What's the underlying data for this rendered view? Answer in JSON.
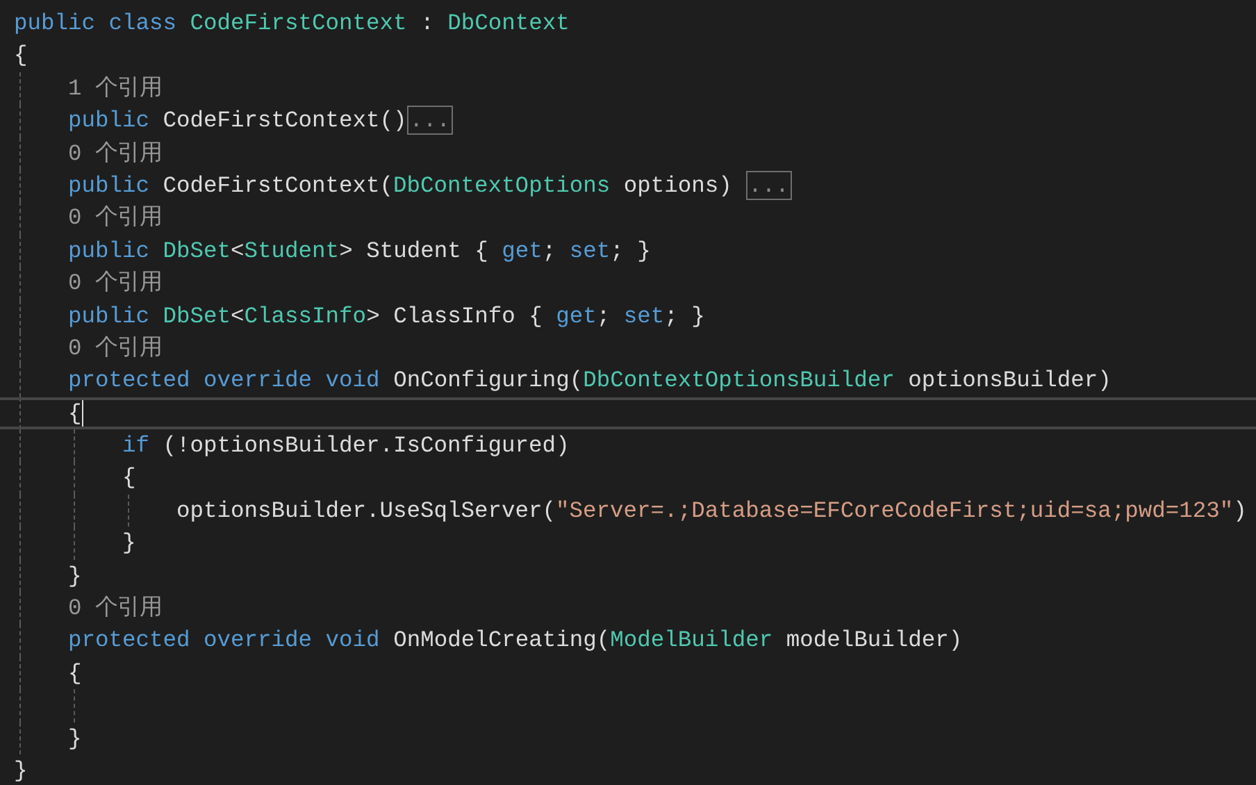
{
  "editor": {
    "lines": [
      {
        "current": false,
        "code": [
          {
            "text": "public ",
            "kind": "keyword"
          },
          {
            "text": "class ",
            "kind": "keyword"
          },
          {
            "text": "CodeFirstContext",
            "kind": "type"
          },
          {
            "text": " : ",
            "kind": "plain"
          },
          {
            "text": "DbContext",
            "kind": "type"
          }
        ]
      },
      {
        "current": false,
        "code": [
          {
            "text": "{",
            "kind": "plain"
          }
        ]
      },
      {
        "current": false,
        "code": [
          {
            "text": "    1 个引用",
            "kind": "lens"
          }
        ]
      },
      {
        "current": false,
        "code": [
          {
            "text": "    public",
            "kind": "keyword"
          },
          {
            "text": " CodeFirstContext()",
            "kind": "plain"
          }
        ],
        "collapsed": "..."
      },
      {
        "current": false,
        "code": [
          {
            "text": "    0 个引用",
            "kind": "lens"
          }
        ]
      },
      {
        "current": false,
        "code": [
          {
            "text": "    public",
            "kind": "keyword"
          },
          {
            "text": " CodeFirstContext(",
            "kind": "plain"
          },
          {
            "text": "DbContextOptions",
            "kind": "type"
          },
          {
            "text": " options) ",
            "kind": "plain"
          }
        ],
        "collapsed": "..."
      },
      {
        "current": false,
        "code": [
          {
            "text": "    0 个引用",
            "kind": "lens"
          }
        ]
      },
      {
        "current": false,
        "code": [
          {
            "text": "    public ",
            "kind": "keyword"
          },
          {
            "text": "DbSet",
            "kind": "type"
          },
          {
            "text": "<",
            "kind": "plain"
          },
          {
            "text": "Student",
            "kind": "type"
          },
          {
            "text": "> Student { ",
            "kind": "plain"
          },
          {
            "text": "get",
            "kind": "keyword"
          },
          {
            "text": "; ",
            "kind": "plain"
          },
          {
            "text": "set",
            "kind": "keyword"
          },
          {
            "text": "; }",
            "kind": "plain"
          }
        ]
      },
      {
        "current": false,
        "code": [
          {
            "text": "    0 个引用",
            "kind": "lens"
          }
        ]
      },
      {
        "current": false,
        "code": [
          {
            "text": "    public ",
            "kind": "keyword"
          },
          {
            "text": "DbSet",
            "kind": "type"
          },
          {
            "text": "<",
            "kind": "plain"
          },
          {
            "text": "ClassInfo",
            "kind": "type"
          },
          {
            "text": "> ClassInfo { ",
            "kind": "plain"
          },
          {
            "text": "get",
            "kind": "keyword"
          },
          {
            "text": "; ",
            "kind": "plain"
          },
          {
            "text": "set",
            "kind": "keyword"
          },
          {
            "text": "; }",
            "kind": "plain"
          }
        ]
      },
      {
        "current": false,
        "code": [
          {
            "text": "    0 个引用",
            "kind": "lens"
          }
        ]
      },
      {
        "current": false,
        "code": [
          {
            "text": "    protected ",
            "kind": "keyword"
          },
          {
            "text": "override ",
            "kind": "keyword"
          },
          {
            "text": "void",
            "kind": "keyword"
          },
          {
            "text": " OnConfiguring(",
            "kind": "plain"
          },
          {
            "text": "DbContextOptionsBuilder",
            "kind": "type"
          },
          {
            "text": " optionsBuilder)",
            "kind": "plain"
          }
        ]
      },
      {
        "current": true,
        "code": [
          {
            "text": "    {",
            "kind": "plain"
          }
        ]
      },
      {
        "current": false,
        "code": [
          {
            "text": "        if",
            "kind": "keyword"
          },
          {
            "text": " (!optionsBuilder.IsConfigured)",
            "kind": "plain"
          }
        ]
      },
      {
        "current": false,
        "code": [
          {
            "text": "        {",
            "kind": "plain"
          }
        ]
      },
      {
        "current": false,
        "code": [
          {
            "text": "            optionsBuilder.UseSqlServer(",
            "kind": "plain"
          },
          {
            "text": "\"Server=.;Database=EFCoreCodeFirst;uid=sa;pwd=123\"",
            "kind": "string"
          },
          {
            "text": ")",
            "kind": "plain"
          }
        ]
      },
      {
        "current": false,
        "code": [
          {
            "text": "        }",
            "kind": "plain"
          }
        ]
      },
      {
        "current": false,
        "code": [
          {
            "text": "    }",
            "kind": "plain"
          }
        ]
      },
      {
        "current": false,
        "code": [
          {
            "text": "    0 个引用",
            "kind": "lens"
          }
        ]
      },
      {
        "current": false,
        "code": [
          {
            "text": "    protected ",
            "kind": "keyword"
          },
          {
            "text": "override ",
            "kind": "keyword"
          },
          {
            "text": "void",
            "kind": "keyword"
          },
          {
            "text": " OnModelCreating(",
            "kind": "plain"
          },
          {
            "text": "ModelBuilder",
            "kind": "type"
          },
          {
            "text": " modelBuilder)",
            "kind": "plain"
          }
        ]
      },
      {
        "current": false,
        "code": [
          {
            "text": "    {",
            "kind": "plain"
          }
        ]
      },
      {
        "current": false
      },
      {
        "current": false,
        "code": [
          {
            "text": "    }",
            "kind": "plain"
          }
        ]
      },
      {
        "current": false,
        "code": [
          {
            "text": "}",
            "kind": "plain"
          }
        ]
      }
    ]
  }
}
